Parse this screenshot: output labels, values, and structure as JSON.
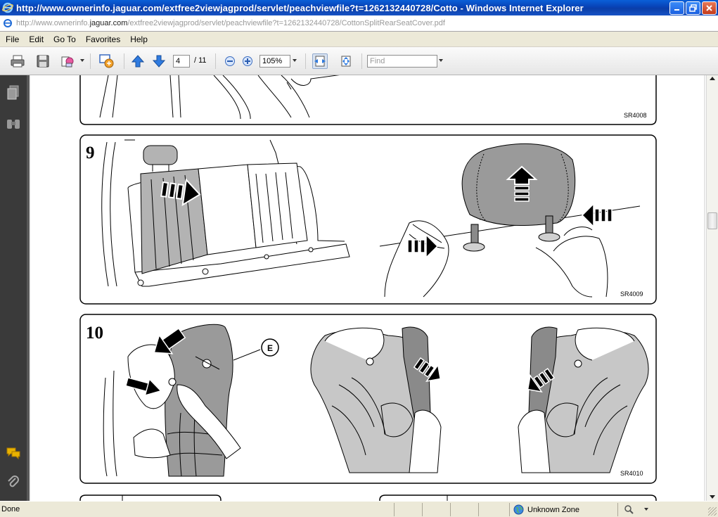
{
  "window": {
    "title": "http://www.ownerinfo.jaguar.com/extfree2viewjagprod/servlet/peachviewfile?t=1262132440728/Cotto - Windows Internet Explorer"
  },
  "address": {
    "url_prefix": "http://www.ownerinfo.",
    "url_domain": "jaguar.com",
    "url_path": "/extfree2viewjagprod/servlet/peachviewfile?t=1262132440728/CottonSplitRearSeatCover.pdf"
  },
  "menu": [
    "File",
    "Edit",
    "Go To",
    "Favorites",
    "Help"
  ],
  "toolbar": {
    "page_current": "4",
    "page_total": "/ 11",
    "zoom": "105%",
    "find_placeholder": "Find"
  },
  "document": {
    "panels": [
      {
        "code": "SR4008"
      },
      {
        "step": "9",
        "code": "SR4009"
      },
      {
        "step": "10",
        "code": "SR4010",
        "callout": "E"
      }
    ]
  },
  "status": {
    "text": "Done",
    "zone": "Unknown Zone"
  },
  "colors": {
    "titlebar": "#0842b5",
    "seat_grey": "#b3b3b3",
    "dark_grey": "#7a7a7a",
    "nav_bg": "#3a3a3a"
  }
}
